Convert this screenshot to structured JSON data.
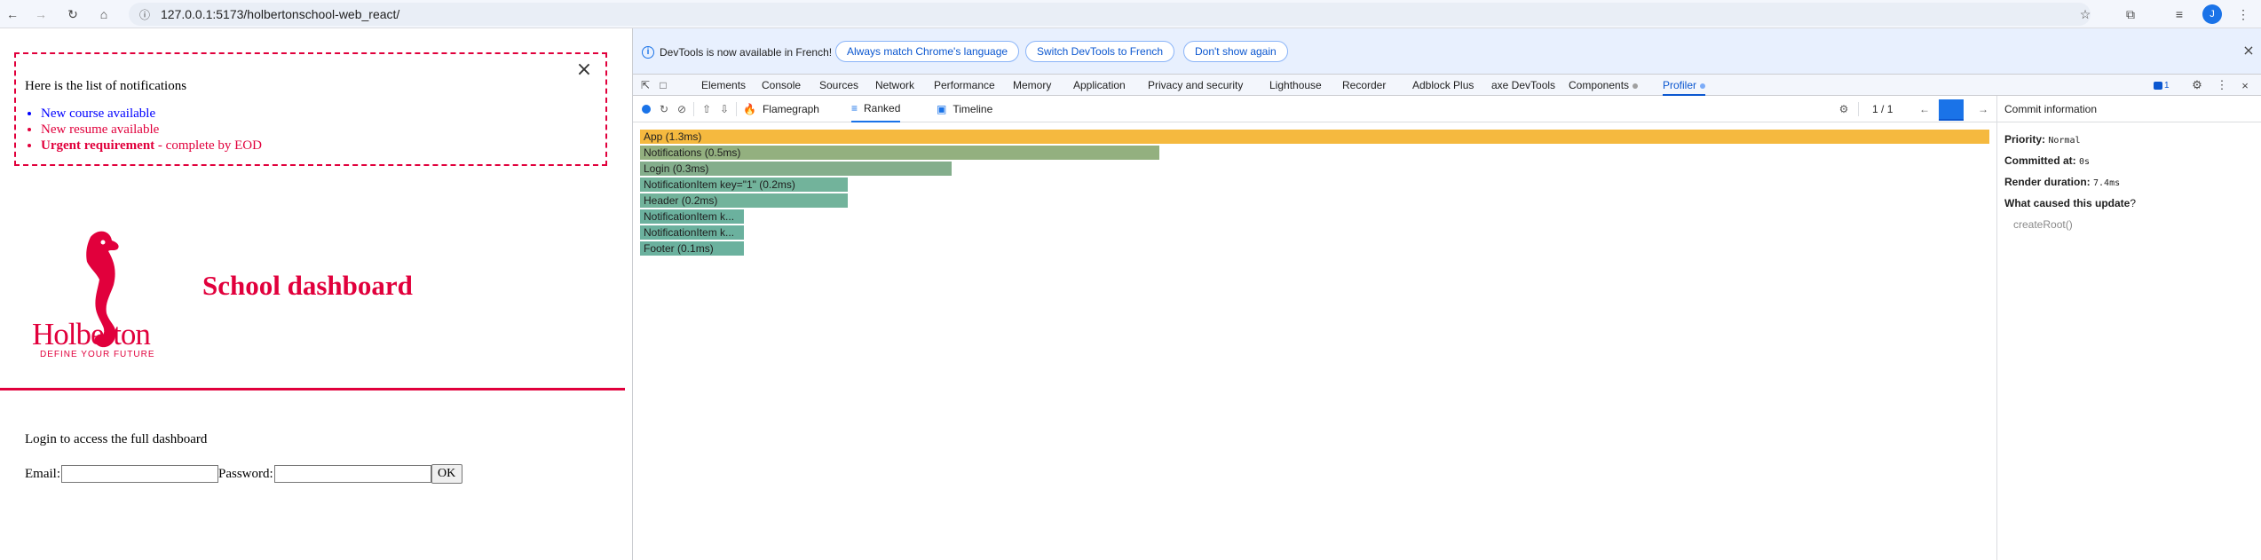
{
  "browser": {
    "url": "127.0.0.1:5173/holbertonschool-web_react/",
    "profile_initial": "J"
  },
  "page": {
    "notifications": {
      "title": "Here is the list of notifications",
      "items": [
        {
          "type": "default",
          "text": "New course available"
        },
        {
          "type": "urgent",
          "text": "New resume available"
        },
        {
          "type": "urgent",
          "bold": "Urgent requirement",
          "text": " - complete by EOD"
        }
      ]
    },
    "logo": {
      "name": "Holberton",
      "tagline": "DEFINE YOUR FUTURE"
    },
    "title": "School dashboard",
    "login": {
      "prompt": "Login to access the full dashboard",
      "email_label": "Email:",
      "email_value": "",
      "password_label": "Password:",
      "password_value": "",
      "submit_label": "OK"
    }
  },
  "devtools": {
    "info_bar": {
      "message": "DevTools is now available in French!",
      "btn_match": "Always match Chrome's language",
      "btn_switch": "Switch DevTools to French",
      "btn_dismiss": "Don't show again"
    },
    "tabs": [
      "Elements",
      "Console",
      "Sources",
      "Network",
      "Performance",
      "Memory",
      "Application",
      "Privacy and security",
      "Lighthouse",
      "Recorder",
      "Adblock Plus",
      "axe DevTools",
      "Components",
      "Profiler"
    ],
    "active_tab": "Profiler",
    "issues_count": "1",
    "profiler": {
      "views": {
        "flamegraph": "Flamegraph",
        "ranked": "Ranked",
        "timeline": "Timeline"
      },
      "active_view": "Ranked",
      "commit_index": "1",
      "commit_separator": "/",
      "commit_total": "1",
      "ranked_bars": [
        {
          "label": "App (1.3ms)",
          "duration": 1.3,
          "color": "#f5b93f"
        },
        {
          "label": "Notifications (0.5ms)",
          "duration": 0.5,
          "color": "#93b07f"
        },
        {
          "label": "Login (0.3ms)",
          "duration": 0.3,
          "color": "#84ae8c"
        },
        {
          "label": "NotificationItem key=\"1\" (0.2ms)",
          "duration": 0.2,
          "color": "#72b39b"
        },
        {
          "label": "Header (0.2ms)",
          "duration": 0.2,
          "color": "#72b39b"
        },
        {
          "label": "NotificationItem k...",
          "duration": 0.1,
          "color": "#6bb19e"
        },
        {
          "label": "NotificationItem k...",
          "duration": 0.1,
          "color": "#6bb19e"
        },
        {
          "label": "Footer (0.1ms)",
          "duration": 0.1,
          "color": "#6bb19e"
        }
      ],
      "commit_info": {
        "header": "Commit information",
        "priority_label": "Priority:",
        "priority_value": "Normal",
        "committed_label": "Committed at:",
        "committed_value": "0s",
        "render_label": "Render duration:",
        "render_value": "7.4ms",
        "cause_label": "What caused this update",
        "cause_q": "?",
        "cause_value": "createRoot()"
      }
    }
  }
}
